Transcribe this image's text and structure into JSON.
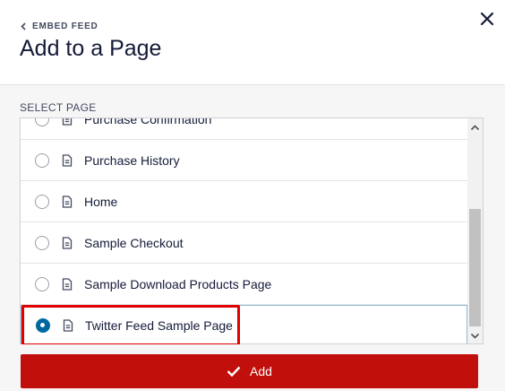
{
  "header": {
    "back_label": "EMBED FEED",
    "title": "Add to a Page"
  },
  "section_label": "SELECT PAGE",
  "pages": [
    {
      "label": "Purchase Confirmation",
      "selected": false
    },
    {
      "label": "Purchase History",
      "selected": false
    },
    {
      "label": "Home",
      "selected": false
    },
    {
      "label": "Sample Checkout",
      "selected": false
    },
    {
      "label": "Sample Download Products Page",
      "selected": false
    },
    {
      "label": "Twitter Feed Sample Page",
      "selected": true
    }
  ],
  "footer": {
    "add_label": "Add"
  },
  "colors": {
    "accent": "#0068a0",
    "button": "#c1100c",
    "highlight": "#e00000"
  },
  "icons": {
    "back": "chevron-left-icon",
    "close": "close-icon",
    "page": "document-icon",
    "add": "checkmark-icon"
  }
}
